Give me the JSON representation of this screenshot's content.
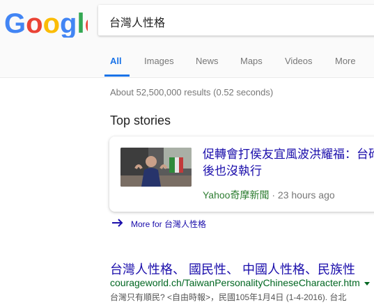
{
  "logo": {
    "text": "Google",
    "colors": [
      "#4285F4",
      "#EA4335",
      "#FBBC05",
      "#4285F4",
      "#34A853",
      "#EA4335"
    ]
  },
  "search": {
    "query": "台灣人性格"
  },
  "tabs": [
    {
      "label": "All",
      "active": true
    },
    {
      "label": "Images"
    },
    {
      "label": "News"
    },
    {
      "label": "Maps"
    },
    {
      "label": "Videos"
    },
    {
      "label": "More"
    }
  ],
  "result_stats": "About 52,500,000 results (0.52 seconds)",
  "top_stories": {
    "heading": "Top stories",
    "story": {
      "title": "促轉會打侯友宜風波洪耀福：台砲，最後也沒執行",
      "source": "Yahoo奇摩新聞",
      "separator": "·",
      "time": "23 hours ago"
    },
    "more_link": "More for 台灣人性格"
  },
  "result": {
    "title": "台灣人性格、 國民性、 中國人性格、民族性",
    "url": "courageworld.ch/TaiwanPersonalityChineseCharacter.htm",
    "snippet": "台灣只有順民? <自由時報>，民國105年1月4日 (1-4-2016). 台北"
  },
  "colors": {
    "accent": "#1a73e8",
    "link": "#1a0dab",
    "url_green": "#006621",
    "source_green": "#2e7d32"
  }
}
